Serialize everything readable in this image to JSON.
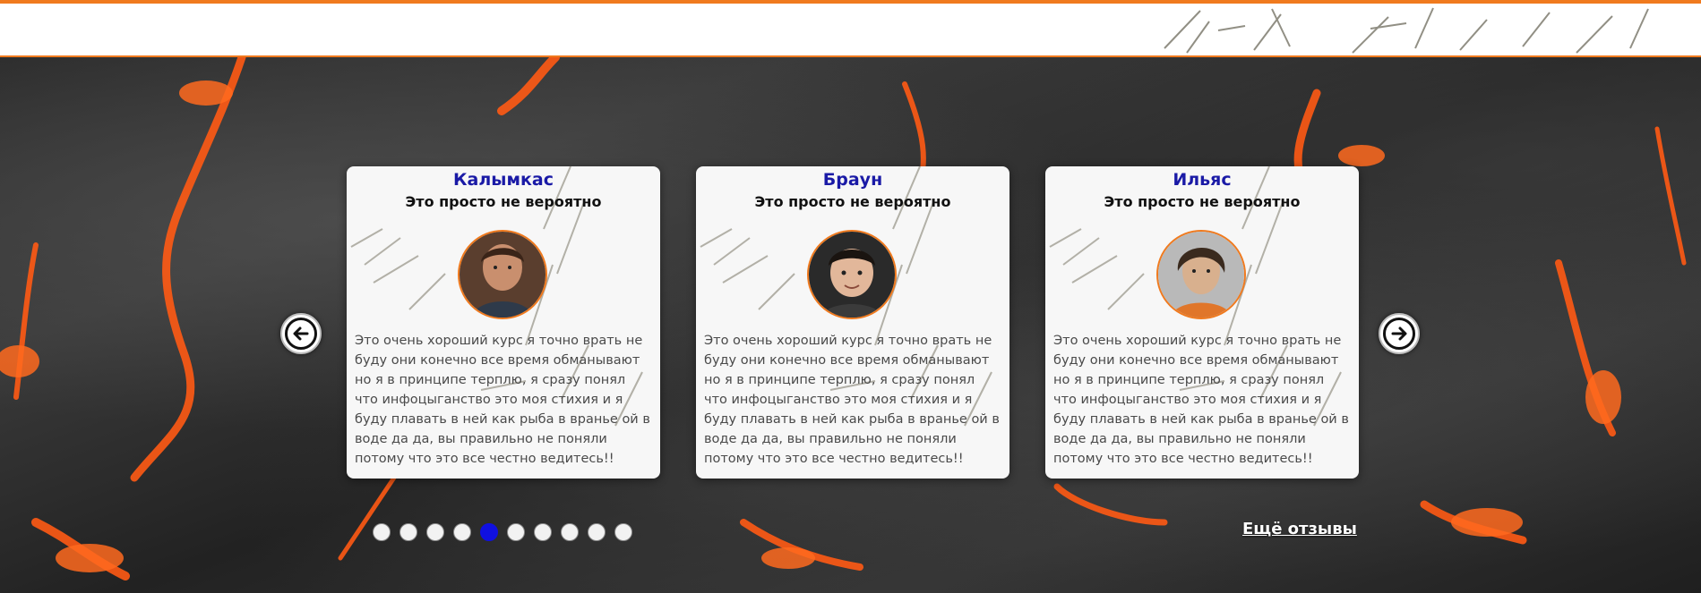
{
  "colors": {
    "accent": "#f07a1e",
    "name_text": "#1a1aa6",
    "active_dot": "#1010e0",
    "lava": "#ff5a14"
  },
  "testimonials": [
    {
      "name": "Калымкас",
      "tagline": "Это просто не вероятно",
      "avatar": "boy-portrait-avatar",
      "text": "Это очень хороший курс я точно врать не\nбуду они конечно все время обманывают\nно я в принципе терплю, я сразу понял\nчто инфоцыганство это моя стихия и я\nбуду плавать в ней как рыба в вранье ой в\nводе да да, вы правильно не поняли\nпотому что это все честно ведитесь!!"
    },
    {
      "name": "Браун",
      "tagline": "Это просто не вероятно",
      "avatar": "child-portrait-avatar",
      "text": "Это очень хороший курс я точно врать не\nбуду они конечно все время обманывают\nно я в принципе терплю, я сразу понял\nчто инфоцыганство это моя стихия и я\nбуду плавать в ней как рыба в вранье ой в\nводе да да, вы правильно не поняли\nпотому что это все честно ведитесь!!"
    },
    {
      "name": "Ильяс",
      "tagline": "Это просто не вероятно",
      "avatar": "teen-portrait-avatar",
      "text": "Это очень хороший курс я точно врать не\nбуду они конечно все время обманывают\nно я в принципе терплю, я сразу понял\nчто инфоцыганство это моя стихия и я\nбуду плавать в ней как рыба в вранье ой в\nводе да да, вы правильно не поняли\nпотому что это все честно ведитесь!!"
    }
  ],
  "navigation": {
    "prev_icon": "arrow-left-icon",
    "next_icon": "arrow-right-icon"
  },
  "pagination": {
    "total": 10,
    "active_index": 4
  },
  "more_link": "Ещё отзывы"
}
